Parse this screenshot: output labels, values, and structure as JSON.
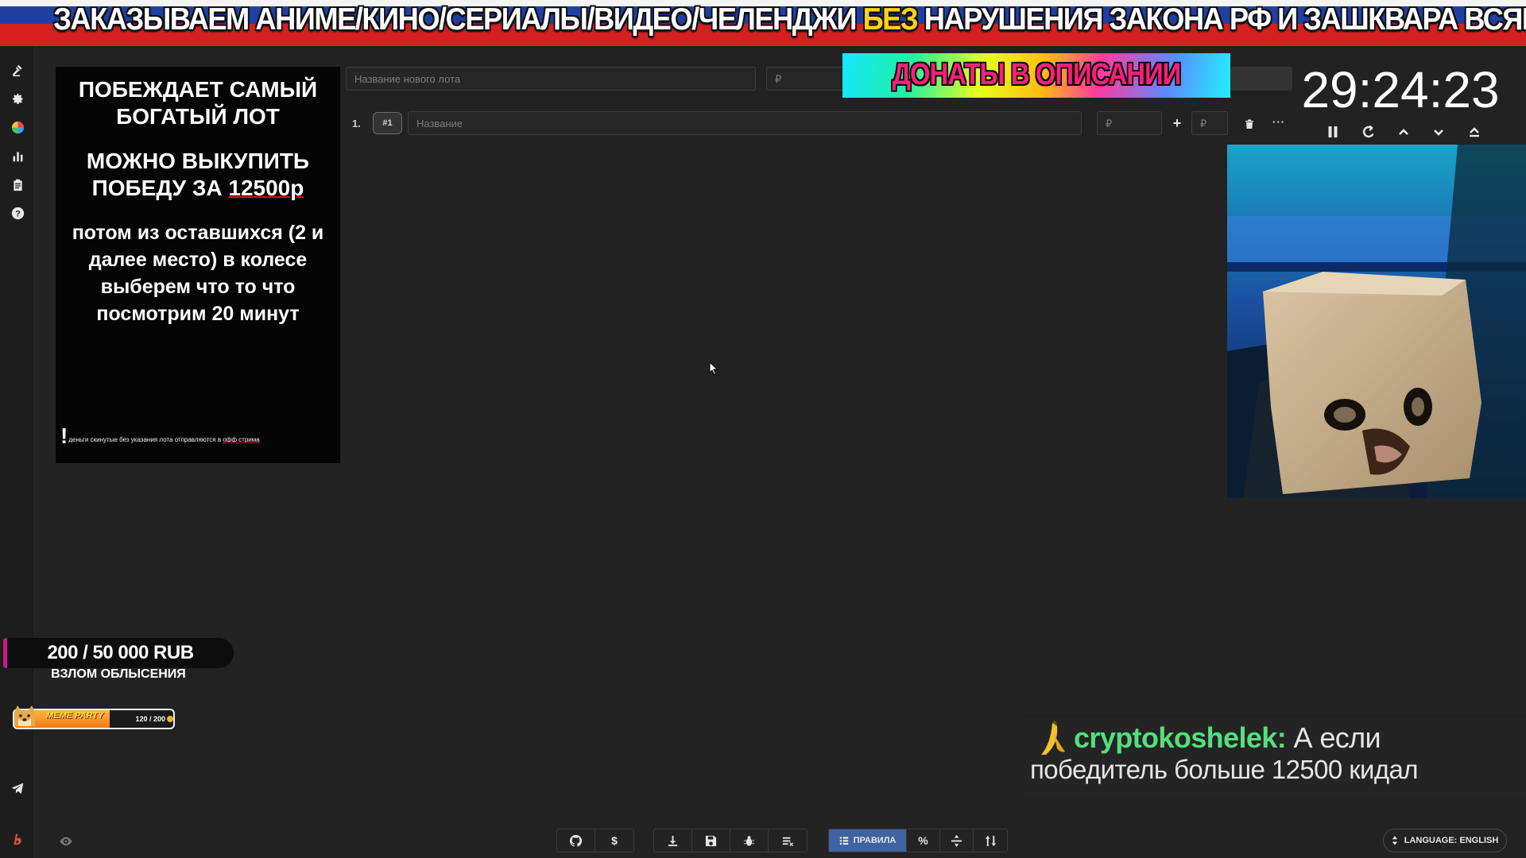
{
  "banner": {
    "part1": "ЗАКАЗЫВАЕМ АНИМЕ/КИНО/СЕРИАЛЫ/ВИДЕО/ЧЕЛЕНДЖИ ",
    "highlight": "БЕЗ",
    "part2": " НАРУШЕНИЯ ЗАКОНА РФ И ЗАШКВАРА ВСЯКОГО"
  },
  "sidebar": {
    "items": [
      "gavel-icon",
      "gear-icon",
      "wheel-icon",
      "stats-icon",
      "clipboard-icon",
      "help-icon"
    ],
    "bottom": [
      "telegram-icon",
      "brand-icon"
    ]
  },
  "rules": {
    "line1": "ПОБЕЖДАЕТ САМЫЙ БОГАТЫЙ ЛОТ",
    "line2_prefix": "МОЖНО ВЫКУПИТЬ ПОБЕДУ ЗА ",
    "line2_price": "12500р",
    "line3": "потом из оставшихся (2 и далее место) в колесе выберем что то что посмотрим 20 минут",
    "note_mark": "!",
    "note_prefix": "деньги скинутые без указания лота отправляются в ",
    "note_link": "офф стрима"
  },
  "new_lot": {
    "name_placeholder": "Название нового лота",
    "amount_placeholder": "₽"
  },
  "lot": {
    "index": "1.",
    "id": "#1",
    "name_placeholder": "Название",
    "amount_placeholder": "₽",
    "add_label": "+",
    "add_amount_placeholder": "₽",
    "more_label": "···"
  },
  "donate_banner": "ДОНАТЫ В ОПИСАНИИ",
  "timer": {
    "value": "29:24:23"
  },
  "goal": {
    "value": "200 / 50 000 RUB",
    "title": "ВЗЛОМ ОБЛЫСЕНИЯ"
  },
  "meme_bar": {
    "label": "MEME PARTY",
    "count": "120 / 200",
    "progress": 0.6
  },
  "chat": {
    "user": "cryptokoshelek",
    "colon": ":",
    "message_start": " А если",
    "message_end": "победитель больше 12500 кидал"
  },
  "toolbar": {
    "rules_label": "ПРАВИЛА",
    "dollar_label": "$",
    "percent_label": "%"
  },
  "language": {
    "label": "LANGUAGE: ENGLISH"
  },
  "colors": {
    "accent": "#3d63a0",
    "chat_user": "#53e07d",
    "banner_highlight": "#ffd21a",
    "goal_stripe": "#c9168a"
  }
}
